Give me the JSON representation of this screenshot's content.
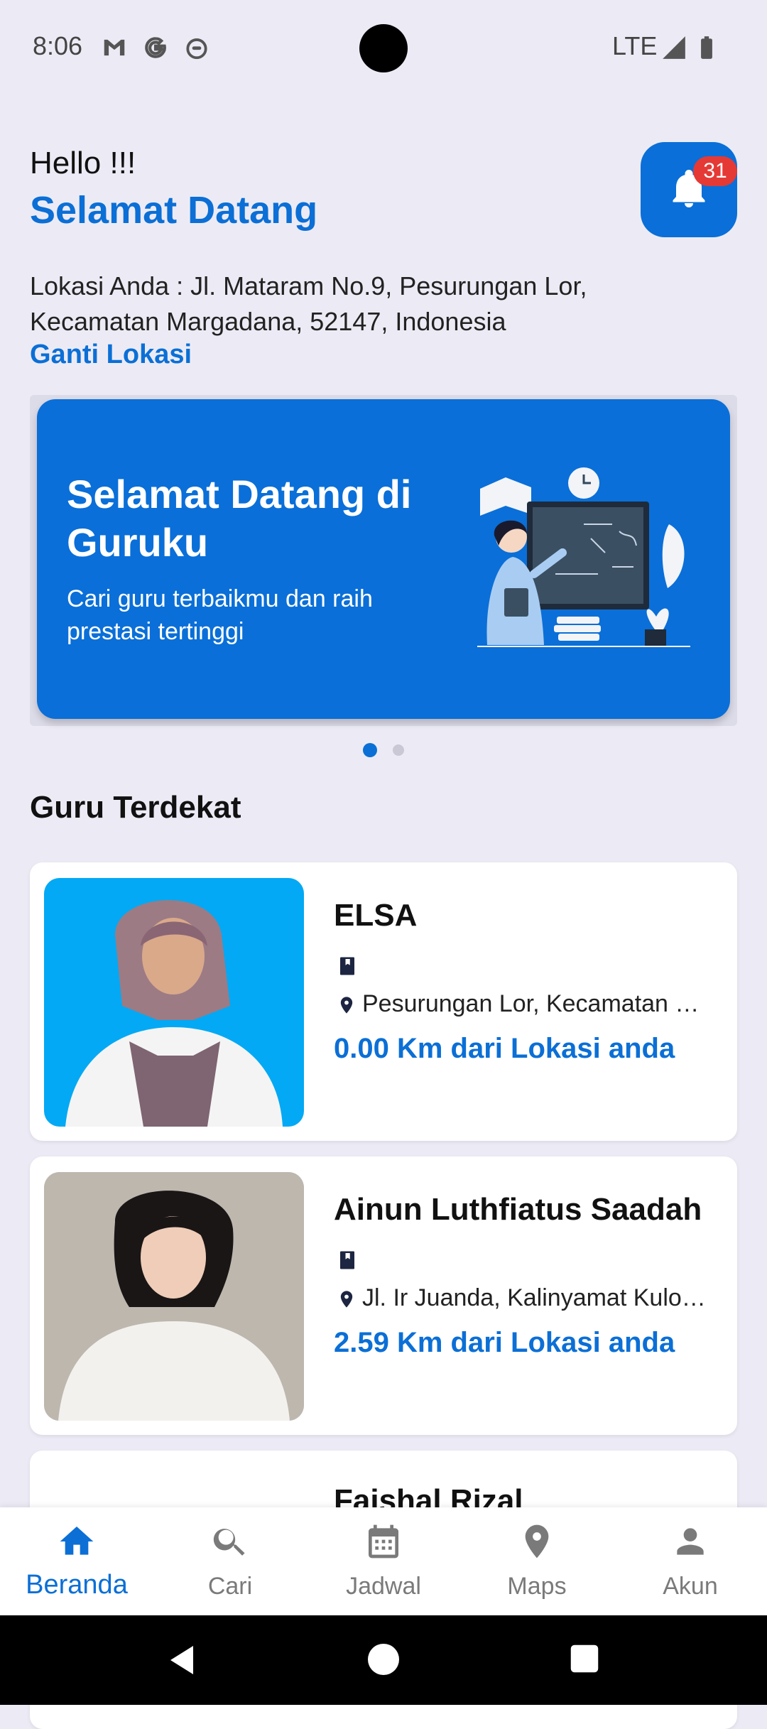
{
  "status_bar": {
    "time": "8:06",
    "icons": [
      "gmail-icon",
      "google-icon",
      "app-icon"
    ],
    "network": "LTE",
    "right_icons": [
      "signal-icon",
      "battery-icon"
    ]
  },
  "header": {
    "greeting": "Hello !!!",
    "welcome": "Selamat Datang",
    "notification_count": "31",
    "location_text": "Lokasi Anda : Jl. Mataram No.9, Pesurungan Lor, Kecamatan Margadana, 52147, Indonesia",
    "change_location": "Ganti Lokasi"
  },
  "banner": {
    "title": "Selamat Datang di Guruku",
    "subtitle": "Cari guru terbaikmu dan raih prestasi tertinggi",
    "active_slide": 1,
    "slide_count": 2
  },
  "section": {
    "title": "Guru Terdekat"
  },
  "teachers": [
    {
      "name": "ELSA",
      "address": "Pesurungan Lor, Kecamatan Margadana, Tegal",
      "distance": "0.00 Km dari Lokasi anda",
      "photo_bg": "#03a9f4"
    },
    {
      "name": "Ainun Luthfiatus Saadah",
      "address": "Jl. Ir Juanda, Kalinyamat Kulon, Tegal",
      "distance": "2.59 Km dari Lokasi anda",
      "photo_bg": "#b9b4ad"
    },
    {
      "name": "Faishal Rizal"
    }
  ],
  "bottom_nav": [
    {
      "label": "Beranda",
      "icon": "home-icon",
      "active": true
    },
    {
      "label": "Cari",
      "icon": "search-icon",
      "active": false
    },
    {
      "label": "Jadwal",
      "icon": "calendar-icon",
      "active": false
    },
    {
      "label": "Maps",
      "icon": "map-pin-icon",
      "active": false
    },
    {
      "label": "Akun",
      "icon": "person-icon",
      "active": false
    }
  ],
  "colors": {
    "primary": "#0a6fd8",
    "badge": "#e53935",
    "background": "#ecebf5"
  }
}
